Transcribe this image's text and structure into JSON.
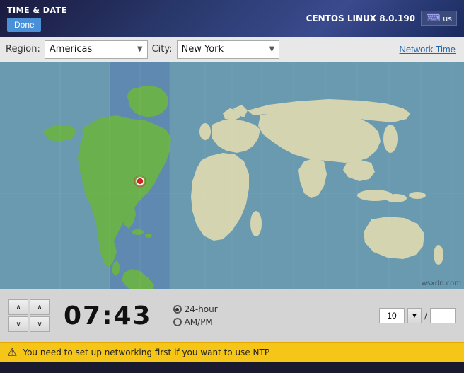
{
  "header": {
    "title": "TIME & DATE",
    "done_label": "Done",
    "centos_label": "CENTOS LINUX 8.0.190",
    "keyboard_lang": "us"
  },
  "toolbar": {
    "region_label": "Region:",
    "region_value": "Americas",
    "city_label": "City:",
    "city_value": "New York",
    "network_time_label": "Network Time"
  },
  "time_controls": {
    "time_value": "07:43",
    "format_24h": "24-hour",
    "format_ampm": "AM/PM",
    "up_arrow": "∧",
    "down_arrow": "∨",
    "spinner_value": "10"
  },
  "warning": {
    "text": "You need to set up networking first if you want to use NTP"
  },
  "watermark": "wsxdn.com"
}
